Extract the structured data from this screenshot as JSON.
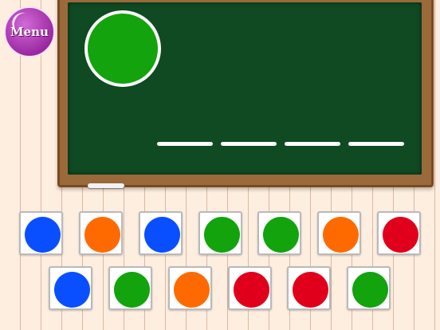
{
  "menu": {
    "label": "Menu"
  },
  "colors": {
    "blue": "#0a4fff",
    "orange": "#ff6a00",
    "green": "#12a30d",
    "red": "#e1001c"
  },
  "target": {
    "color": "green"
  },
  "answer_slots": 4,
  "tiles_row1": [
    "blue",
    "orange",
    "blue",
    "green",
    "green",
    "orange",
    "red"
  ],
  "tiles_row2": [
    "blue",
    "green",
    "orange",
    "red",
    "red",
    "green"
  ]
}
